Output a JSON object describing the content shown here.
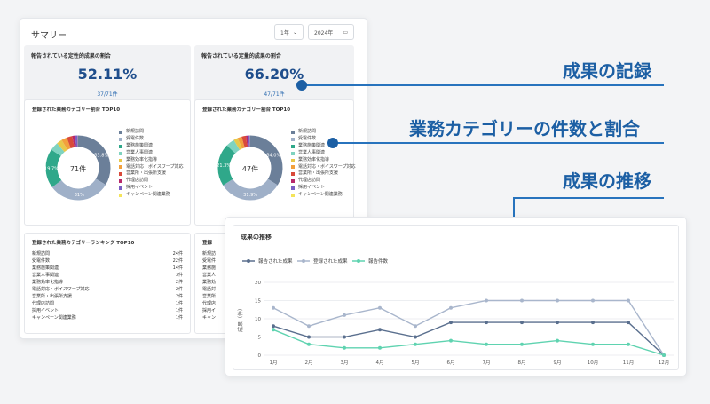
{
  "summary": {
    "title": "サマリー",
    "period_select": "1年",
    "year_select": "2024年",
    "kpi_qualitative": {
      "title": "報告されている定性的成果の割合",
      "value": "52.11%",
      "sub": "37/71件"
    },
    "kpi_quantitative": {
      "title": "報告されている定量的成果の割合",
      "value": "66.20%",
      "sub": "47/71件"
    }
  },
  "donut_left": {
    "title": "登録された業務カテゴリー割合 TOP10",
    "center": "71件",
    "labels": [
      "33.8%",
      "31%",
      "19.7%"
    ],
    "slice_values": [
      33.8,
      31.0,
      19.7,
      4.2,
      2.8,
      2.8,
      2.8,
      1.4,
      1.4,
      0.1
    ],
    "colors": [
      "#6b7f99",
      "#9fb0c8",
      "#2fa88a",
      "#7fd3c0",
      "#e8c84a",
      "#f2a03d",
      "#d94a3a",
      "#b8286b",
      "#7a5fc4",
      "#f4e45a"
    ]
  },
  "donut_right": {
    "title": "登録された業務カテゴリー割合 TOP10",
    "center": "47件",
    "labels": [
      "34.0%",
      "31.9%",
      "21.3%"
    ],
    "slice_values": [
      34.0,
      31.9,
      21.3,
      4.3,
      2.1,
      2.1,
      2.1,
      1.1,
      1.0,
      0.1
    ]
  },
  "legend": [
    {
      "label": "新規訪問",
      "color": "#6b7f99"
    },
    {
      "label": "受電件数",
      "color": "#9fb0c8"
    },
    {
      "label": "業務施策関連",
      "color": "#2fa88a"
    },
    {
      "label": "営業人事関連",
      "color": "#7fd3c0"
    },
    {
      "label": "業務効率化指導",
      "color": "#e8c84a"
    },
    {
      "label": "電話対応・ボイスワープ対応",
      "color": "#f2a03d"
    },
    {
      "label": "営業所・出張所支援",
      "color": "#d94a3a"
    },
    {
      "label": "代理店訪問",
      "color": "#b8286b"
    },
    {
      "label": "採用イベント",
      "color": "#7a5fc4"
    },
    {
      "label": "キャンペーン関連業務",
      "color": "#f4e45a"
    }
  ],
  "ranking": {
    "title": "登録された業務カテゴリーランキング TOP10",
    "title_right": "登録",
    "rows": [
      {
        "name": "新規訪問",
        "count": "24件"
      },
      {
        "name": "受電件数",
        "count": "22件"
      },
      {
        "name": "業務施策関連",
        "count": "14件"
      },
      {
        "name": "営業人事関連",
        "count": "3件"
      },
      {
        "name": "業務効率化指導",
        "count": "2件"
      },
      {
        "name": "電話対応・ボイスワープ対応",
        "count": "2件"
      },
      {
        "name": "営業所・出張所支援",
        "count": "2件"
      },
      {
        "name": "代理店訪問",
        "count": "1件"
      },
      {
        "name": "採用イベント",
        "count": "1件"
      },
      {
        "name": "キャンペーン関連業務",
        "count": "1件"
      }
    ],
    "right_rows": [
      "新規訪",
      "受電件",
      "業務施",
      "営業人",
      "業務効",
      "電話対",
      "営業所",
      "代理店",
      "採用イ",
      "キャン"
    ]
  },
  "callouts": {
    "record": "成果の記録",
    "category": "業務カテゴリーの件数と割合",
    "trend": "成果の推移"
  },
  "trend_chart": {
    "panel_title": "成果の推移",
    "chart_data": {
      "type": "line",
      "x": [
        "1月",
        "2月",
        "3月",
        "4月",
        "5月",
        "6月",
        "7月",
        "8月",
        "9月",
        "10月",
        "11月",
        "12月"
      ],
      "ylabel": "成果（件）",
      "ylim": [
        0,
        20
      ],
      "yticks": [
        0,
        5,
        10,
        15,
        20
      ],
      "series": [
        {
          "name": "報告された成果",
          "color": "#5a6f8e",
          "values": [
            8,
            5,
            5,
            7,
            5,
            9,
            9,
            9,
            9,
            9,
            9,
            0
          ]
        },
        {
          "name": "登録された成果",
          "color": "#a9b6cc",
          "values": [
            13,
            8,
            11,
            13,
            8,
            13,
            15,
            15,
            15,
            15,
            15,
            0
          ]
        },
        {
          "name": "報告件数",
          "color": "#5fd3b0",
          "values": [
            7,
            3,
            2,
            2,
            3,
            4,
            3,
            3,
            4,
            3,
            3,
            0
          ]
        }
      ]
    }
  }
}
